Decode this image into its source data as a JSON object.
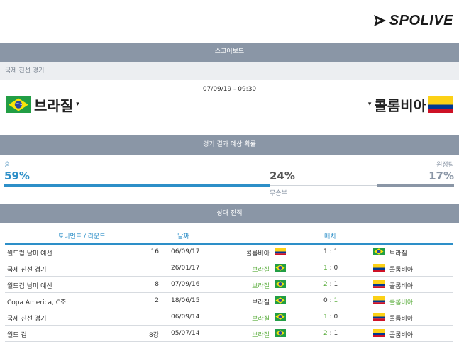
{
  "logo": {
    "text": "SPOLIVE",
    "icon": "spolive-arrow-icon"
  },
  "scoreboard": {
    "title": "스코어보드",
    "competition": "국제 친선 경기",
    "datetime": "07/09/19 - 09:30",
    "home": {
      "name": "브라질",
      "flag": "brazil-flag-icon"
    },
    "away": {
      "name": "콜롬비아",
      "flag": "colombia-flag-icon"
    },
    "arrow": "▾"
  },
  "prediction": {
    "title": "경기 결과 예상 확률",
    "home_label": "홈",
    "away_label": "원정팀",
    "draw_label": "무승부",
    "home_pct": "59%",
    "draw_pct": "24%",
    "away_pct": "17%",
    "home_value": 59,
    "draw_value": 24,
    "away_value": 17,
    "colors": {
      "home": "#2d8fc8",
      "draw": "#cfd4da",
      "away": "#8a96a6"
    }
  },
  "h2h": {
    "title": "상대 전적",
    "headers": {
      "tournament": "토너먼트 / 라운드",
      "date": "날짜",
      "match": "매치"
    },
    "rows": [
      {
        "tournament": "월드컵 남미 예선",
        "round": "16",
        "date": "06/09/17",
        "home": "콜롬비아",
        "home_flag": "colombia",
        "score_home": "1",
        "score_away": "1",
        "away": "브라질",
        "away_flag": "brazil",
        "winner": "none"
      },
      {
        "tournament": "국제 친선 경기",
        "round": "",
        "date": "26/01/17",
        "home": "브라질",
        "home_flag": "brazil",
        "score_home": "1",
        "score_away": "0",
        "away": "콜롬비아",
        "away_flag": "colombia",
        "winner": "home"
      },
      {
        "tournament": "월드컵 남미 예선",
        "round": "8",
        "date": "07/09/16",
        "home": "브라질",
        "home_flag": "brazil",
        "score_home": "2",
        "score_away": "1",
        "away": "콜롬비아",
        "away_flag": "colombia",
        "winner": "home"
      },
      {
        "tournament": "Copa America, C조",
        "round": "2",
        "date": "18/06/15",
        "home": "브라질",
        "home_flag": "brazil",
        "score_home": "0",
        "score_away": "1",
        "away": "콜롬비아",
        "away_flag": "colombia",
        "winner": "away"
      },
      {
        "tournament": "국제 친선 경기",
        "round": "",
        "date": "06/09/14",
        "home": "브라질",
        "home_flag": "brazil",
        "score_home": "1",
        "score_away": "0",
        "away": "콜롬비아",
        "away_flag": "colombia",
        "winner": "home"
      },
      {
        "tournament": "월드 컵",
        "round": "8강",
        "date": "05/07/14",
        "home": "브라질",
        "home_flag": "brazil",
        "score_home": "2",
        "score_away": "1",
        "away": "콜롬비아",
        "away_flag": "colombia",
        "winner": "home"
      }
    ]
  }
}
